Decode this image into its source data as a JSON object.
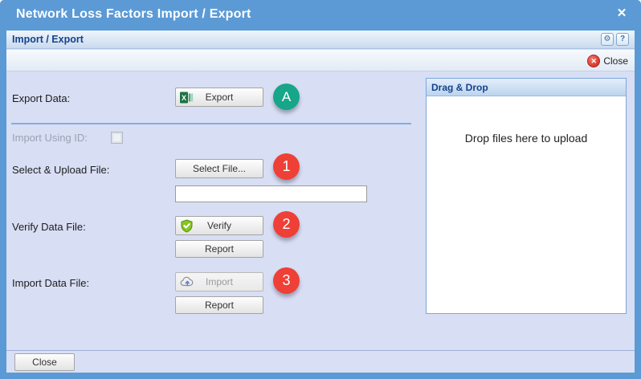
{
  "window": {
    "title": "Network Loss Factors Import / Export",
    "close_glyph": "✕"
  },
  "panel": {
    "title": "Import / Export",
    "help_glyph": "?"
  },
  "toolbar": {
    "close_label": "Close",
    "close_icon_glyph": "✕"
  },
  "form": {
    "export_row": {
      "label": "Export Data:",
      "button_label": "Export",
      "badge": "A"
    },
    "import_using_id_row": {
      "label": "Import Using ID:",
      "checkbox_checked": false
    },
    "select_file_row": {
      "label": "Select & Upload File:",
      "button_label": "Select File...",
      "badge": "1",
      "file_input_value": "",
      "file_input_placeholder": ""
    },
    "verify_row": {
      "label": "Verify Data File:",
      "button_label": "Verify",
      "badge": "2",
      "report_label": "Report"
    },
    "import_row": {
      "label": "Import Data File:",
      "button_label": "Import",
      "badge": "3",
      "report_label": "Report",
      "button_disabled": true
    }
  },
  "dragdrop": {
    "title": "Drag & Drop",
    "message": "Drop files here to upload"
  },
  "footer": {
    "close_label": "Close"
  },
  "colors": {
    "titlebar_blue": "#5b9ad5",
    "header_text_blue": "#15428b",
    "main_background": "#d8def4",
    "badge_red": "#ee4036",
    "badge_teal": "#17a689"
  }
}
